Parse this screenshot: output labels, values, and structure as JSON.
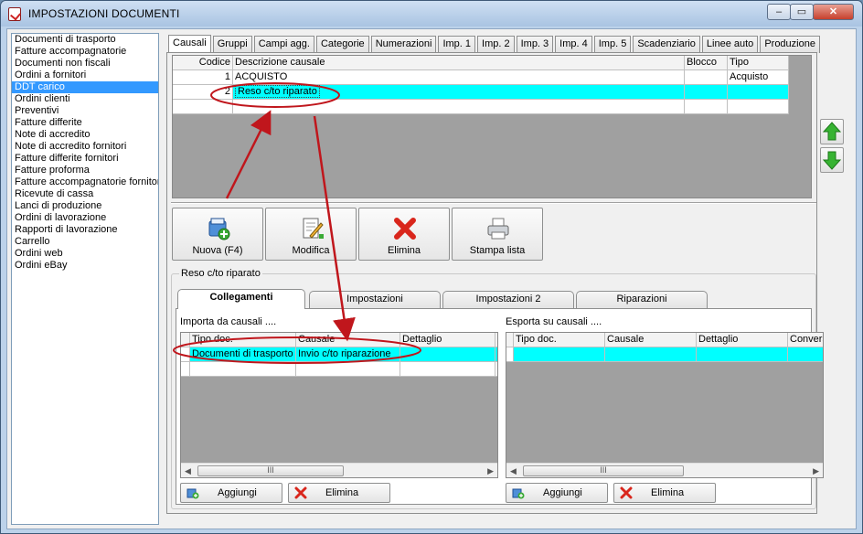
{
  "window": {
    "title": "IMPOSTAZIONI DOCUMENTI",
    "min_label": "‒",
    "max_label": "▭",
    "close_label": "✕"
  },
  "doc_types": [
    "Documenti di trasporto",
    "Fatture accompagnatorie",
    "Documenti non fiscali",
    "Ordini a fornitori",
    "DDT carico",
    "Ordini clienti",
    "Preventivi",
    "Fatture differite",
    "Note di accredito",
    "Note di accredito fornitori",
    "Fatture differite fornitori",
    "Fatture proforma",
    "Fatture accompagnatorie fornitori",
    "Ricevute di cassa",
    "Lanci di produzione",
    "Ordini di lavorazione",
    "Rapporti di lavorazione",
    "Carrello",
    "Ordini web",
    "Ordini eBay"
  ],
  "selected_doc_type": "DDT carico",
  "tabs": [
    "Causali",
    "Gruppi",
    "Campi agg.",
    "Categorie",
    "Numerazioni",
    "Imp. 1",
    "Imp. 2",
    "Imp. 3",
    "Imp. 4",
    "Imp. 5",
    "Scadenziario",
    "Linee auto",
    "Produzione"
  ],
  "active_tab": "Causali",
  "causali_grid": {
    "headers": {
      "code": "Codice",
      "desc": "Descrizione causale",
      "blocco": "Blocco",
      "tipo": "Tipo"
    },
    "rows": [
      {
        "code": "1",
        "desc": "ACQUISTO",
        "blocco": "",
        "tipo": "Acquisto"
      },
      {
        "code": "2",
        "desc": "Reso c/to riparato",
        "blocco": "",
        "tipo": ""
      }
    ]
  },
  "toolbar": {
    "new_label": "Nuova (F4)",
    "edit_label": "Modifica",
    "delete_label": "Elimina",
    "print_label": "Stampa lista"
  },
  "group": {
    "title": "Reso c/to riparato",
    "subtabs": [
      "Collegamenti",
      "Impostazioni",
      "Impostazioni 2",
      "Riparazioni"
    ],
    "active_subtab": "Collegamenti",
    "import_label": "Importa da causali ....",
    "export_label": "Esporta su causali ....",
    "import_grid": {
      "headers": {
        "tipo": "Tipo doc.",
        "causale": "Causale",
        "dettaglio": "Dettaglio"
      },
      "rows": [
        {
          "tipo": "Documenti di trasporto",
          "causale": "Invio c/to riparazione",
          "dettaglio": ""
        }
      ]
    },
    "export_grid": {
      "headers": {
        "tipo": "Tipo doc.",
        "causale": "Causale",
        "dettaglio": "Dettaglio",
        "conv": "Conversi"
      }
    },
    "scroll_thumb": "III",
    "add_label": "Aggiungi",
    "remove_label": "Elimina"
  },
  "colors": {
    "selection": "#3399ff",
    "row_highlight": "#00ffff",
    "annotation": "#c0161c",
    "arrow_green": "#2fa82a"
  }
}
